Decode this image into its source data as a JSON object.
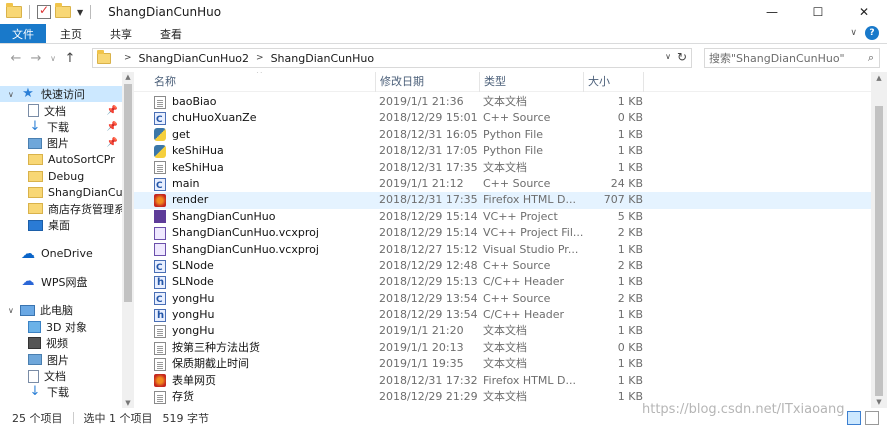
{
  "window": {
    "title": "ShangDianCunHuo",
    "minimize": "—",
    "maximize": "☐",
    "close": "✕"
  },
  "ribbon": {
    "tabs": [
      "文件",
      "主页",
      "共享",
      "查看"
    ]
  },
  "address": {
    "path": [
      "ShangDianCunHuo2",
      "ShangDianCunHuo"
    ],
    "search_placeholder": "搜索\"ShangDianCunHuo\""
  },
  "sidebar": {
    "quick_access": "快速访问",
    "pinned": [
      {
        "label": "文档",
        "icon": "document-icon",
        "pinned": true
      },
      {
        "label": "下载",
        "icon": "download-icon",
        "pinned": true
      },
      {
        "label": "图片",
        "icon": "picture-icon",
        "pinned": true
      },
      {
        "label": "AutoSortCPr",
        "icon": "folder-icon",
        "pinned": false
      },
      {
        "label": "Debug",
        "icon": "folder-icon",
        "pinned": false
      },
      {
        "label": "ShangDianCunI",
        "icon": "folder-icon",
        "pinned": false
      },
      {
        "label": "商店存货管理系",
        "icon": "folder-icon",
        "pinned": false
      },
      {
        "label": "桌面",
        "icon": "desktop-icon",
        "pinned": false
      }
    ],
    "onedrive": "OneDrive",
    "wps": "WPS网盘",
    "this_pc": "此电脑",
    "pc_items": [
      {
        "label": "3D 对象",
        "icon": "3d-objects-icon"
      },
      {
        "label": "视频",
        "icon": "video-icon"
      },
      {
        "label": "图片",
        "icon": "picture-icon"
      },
      {
        "label": "文档",
        "icon": "document-icon"
      },
      {
        "label": "下载",
        "icon": "download-icon"
      }
    ]
  },
  "columns": {
    "name": "名称",
    "date": "修改日期",
    "type": "类型",
    "size": "大小"
  },
  "files": [
    {
      "name": "baoBiao",
      "date": "2019/1/1 21:36",
      "type": "文本文档",
      "size": "1 KB",
      "icon": "txt"
    },
    {
      "name": "chuHuoXuanZe",
      "date": "2018/12/29 15:01",
      "type": "C++ Source",
      "size": "0 KB",
      "icon": "cpp"
    },
    {
      "name": "get",
      "date": "2018/12/31 16:05",
      "type": "Python File",
      "size": "1 KB",
      "icon": "py"
    },
    {
      "name": "keShiHua",
      "date": "2018/12/31 17:05",
      "type": "Python File",
      "size": "1 KB",
      "icon": "kes"
    },
    {
      "name": "keShiHua",
      "date": "2018/12/31 17:35",
      "type": "文本文档",
      "size": "1 KB",
      "icon": "txt"
    },
    {
      "name": "main",
      "date": "2019/1/1 21:12",
      "type": "C++ Source",
      "size": "24 KB",
      "icon": "cpp"
    },
    {
      "name": "render",
      "date": "2018/12/31 17:35",
      "type": "Firefox HTML D...",
      "size": "707 KB",
      "icon": "fx",
      "selected": true
    },
    {
      "name": "ShangDianCunHuo",
      "date": "2018/12/29 15:14",
      "type": "VC++ Project",
      "size": "5 KB",
      "icon": "vc"
    },
    {
      "name": "ShangDianCunHuo.vcxproj",
      "date": "2018/12/29 15:14",
      "type": "VC++ Project Fil...",
      "size": "2 KB",
      "icon": "vcx"
    },
    {
      "name": "ShangDianCunHuo.vcxproj",
      "date": "2018/12/27 15:12",
      "type": "Visual Studio Pr...",
      "size": "1 KB",
      "icon": "sln"
    },
    {
      "name": "SLNode",
      "date": "2018/12/29 12:48",
      "type": "C++ Source",
      "size": "2 KB",
      "icon": "cpp"
    },
    {
      "name": "SLNode",
      "date": "2018/12/29 15:13",
      "type": "C/C++ Header",
      "size": "1 KB",
      "icon": "hdr"
    },
    {
      "name": "yongHu",
      "date": "2018/12/29 13:54",
      "type": "C++ Source",
      "size": "2 KB",
      "icon": "cpp"
    },
    {
      "name": "yongHu",
      "date": "2018/12/29 13:54",
      "type": "C/C++ Header",
      "size": "1 KB",
      "icon": "hdr"
    },
    {
      "name": "yongHu",
      "date": "2019/1/1 21:20",
      "type": "文本文档",
      "size": "1 KB",
      "icon": "txt"
    },
    {
      "name": "按第三种方法出货",
      "date": "2019/1/1 20:13",
      "type": "文本文档",
      "size": "0 KB",
      "icon": "txt"
    },
    {
      "name": "保质期截止时间",
      "date": "2019/1/1 19:35",
      "type": "文本文档",
      "size": "1 KB",
      "icon": "txt"
    },
    {
      "name": "表单网页",
      "date": "2018/12/31 17:32",
      "type": "Firefox HTML D...",
      "size": "1 KB",
      "icon": "fx"
    },
    {
      "name": "存货",
      "date": "2018/12/29 21:29",
      "type": "文本文档",
      "size": "1 KB",
      "icon": "txt"
    }
  ],
  "status": {
    "count": "25 个项目",
    "selected": "选中 1 个项目",
    "size": "519 字节"
  },
  "watermark": "https://blog.csdn.net/ITxiaoang"
}
